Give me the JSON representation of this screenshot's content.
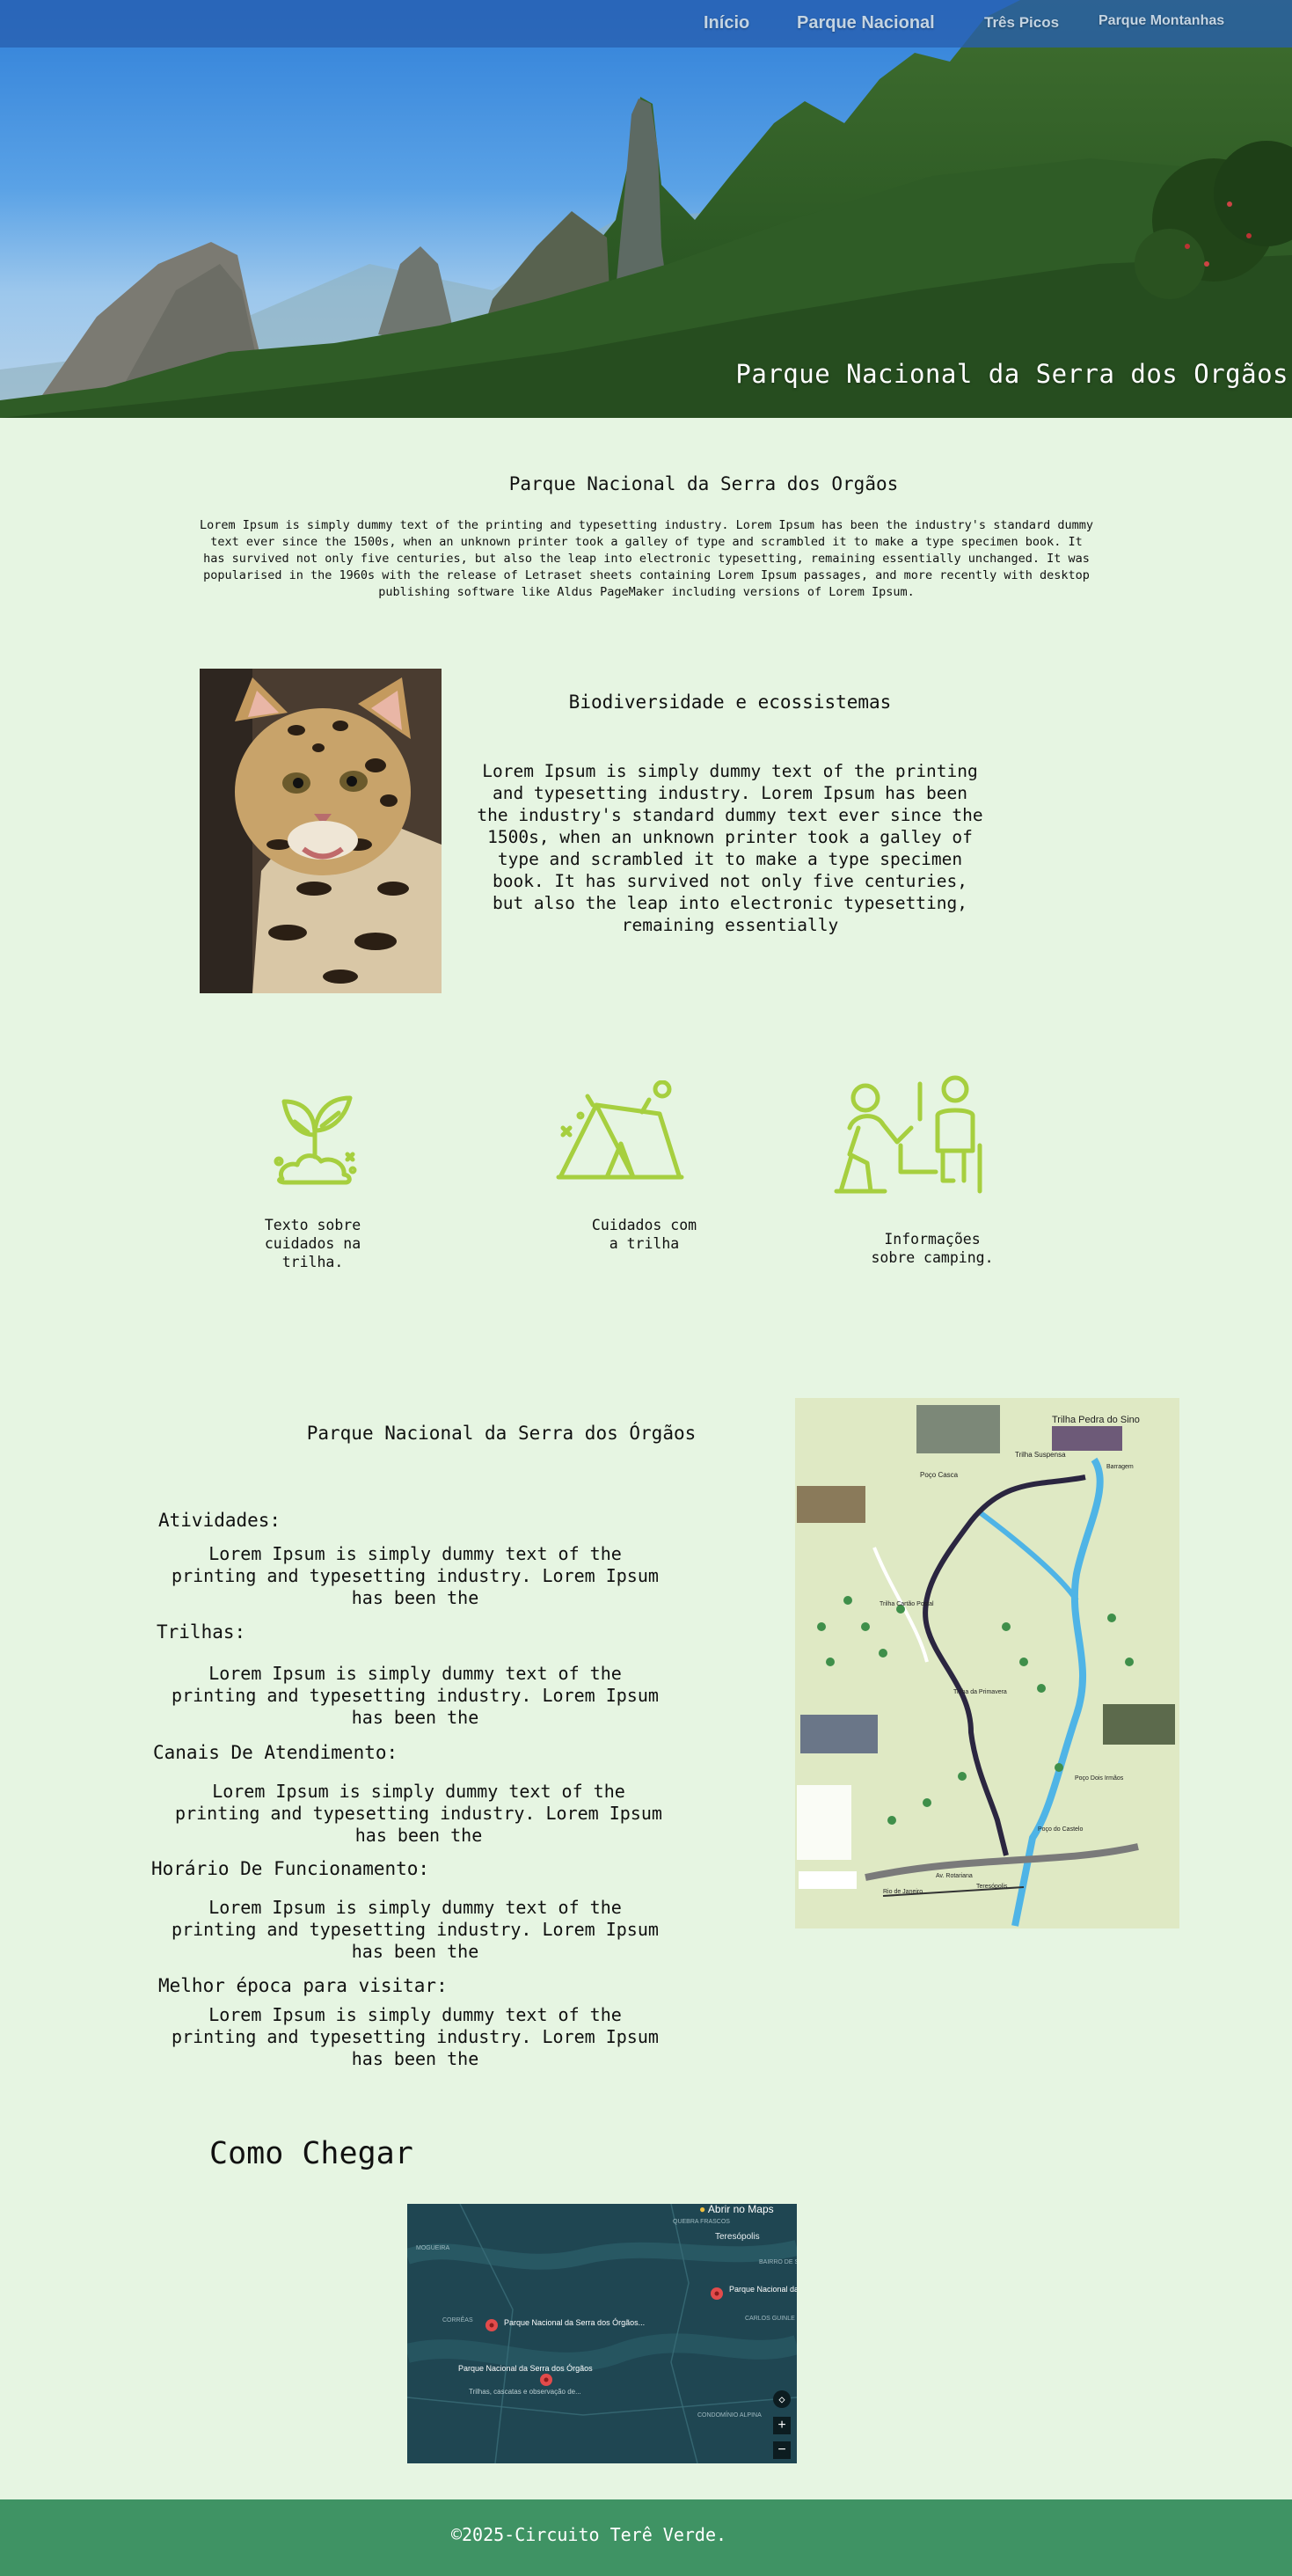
{
  "nav": {
    "items": [
      "Início",
      "Parque Nacional",
      "Três Picos",
      "Parque Montanhas"
    ]
  },
  "hero": {
    "title": "Parque Nacional da Serra dos Orgãos"
  },
  "intro": {
    "title": "Parque Nacional da Serra dos Orgãos",
    "text": "Lorem Ipsum is simply dummy text of the printing and typesetting industry. Lorem Ipsum has been the industry's standard dummy text ever since the 1500s, when an unknown printer took a galley of type and scrambled it to make a type specimen book. It has survived not only five centuries, but also the leap into electronic typesetting, remaining essentially unchanged. It was popularised in the 1960s with the release of Letraset sheets containing Lorem Ipsum passages, and more recently with desktop publishing software like Aldus PageMaker including versions of Lorem Ipsum."
  },
  "biodiversity": {
    "title": "Biodiversidade e ecossistemas",
    "text": "Lorem Ipsum is simply dummy text of the printing and typesetting industry. Lorem Ipsum has been the industry's standard dummy text ever since the 1500s, when an unknown printer took a galley of type and scrambled it to make a type specimen book. It has survived not only five centuries, but also the leap into electronic typesetting, remaining essentially"
  },
  "features": [
    {
      "icon": "plant-icon",
      "text": "Texto sobre cuidados na trilha."
    },
    {
      "icon": "tent-icon",
      "text": "Cuidados com a trilha"
    },
    {
      "icon": "hikers-icon",
      "text": "Informações sobre camping."
    }
  ],
  "info": {
    "title": "Parque Nacional da Serra dos Órgãos",
    "sections": [
      {
        "label": "Atividades:",
        "text": "Lorem Ipsum is simply dummy text of the printing and typesetting industry. Lorem Ipsum has been the"
      },
      {
        "label": "Trilhas:",
        "text": "Lorem Ipsum is simply dummy text of the printing and typesetting industry. Lorem Ipsum has been the"
      },
      {
        "label": "Canais De Atendimento:",
        "text": "Lorem Ipsum is simply dummy text of the printing and typesetting industry. Lorem Ipsum has been the"
      },
      {
        "label": "Horário De Funcionamento:",
        "text": "Lorem Ipsum is simply dummy text of the printing and typesetting industry. Lorem Ipsum has been the"
      },
      {
        "label": "Melhor época para visitar:",
        "text": "Lorem Ipsum is simply dummy text of the printing and typesetting industry. Lorem Ipsum has been the"
      }
    ]
  },
  "trail_map": {
    "title": "Trilha Pedra do Sino",
    "labels": [
      "Trilha Suspensa",
      "Barragem",
      "Poço Casca",
      "Trilha Cartão Postal",
      "Trilha da Primavera",
      "Poço Dois Irmãos",
      "Poço do Castelo",
      "Av. Rotariana",
      "Rio de Janeiro",
      "Teresópolis"
    ]
  },
  "directions": {
    "title": "Como Chegar"
  },
  "gmap": {
    "open_label": "Abrir no Maps",
    "places": [
      "Teresópolis",
      "Parque Nacional da Serra dos Órgãos",
      "Parque Nacional da Serra dos Órgãos...",
      "Parque Nacional da Serra dos Órgãos",
      "Trilhas, cascatas e observação de..."
    ],
    "areas": [
      "MOGUEIRA",
      "QUEBRA FRASCOS",
      "BAIRRO DE SÃO PEDRO",
      "CARLOS GUINLE",
      "CORRÊAS",
      "CONDOMÍNIO ALPINA"
    ],
    "zoom_in": "+",
    "zoom_out": "−"
  },
  "footer": {
    "text": "©2025-Circuito Terê Verde."
  },
  "colors": {
    "background": "#e6f5e2",
    "accent_green": "#a6cf3f",
    "footer": "#3f9364",
    "navbar": "#3561aa"
  }
}
